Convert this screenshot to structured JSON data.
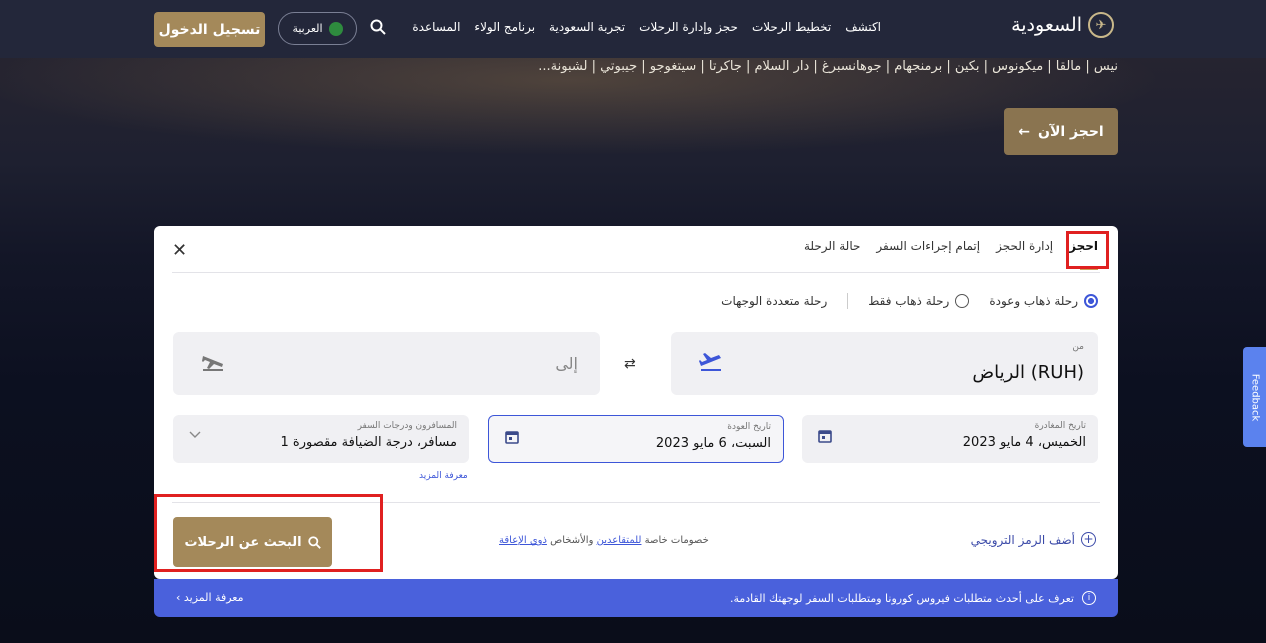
{
  "header": {
    "logo_text": "السعودية",
    "logo_mark": "✈",
    "nav": [
      "اكتشف",
      "تخطيط الرحلات",
      "حجز وإدارة الرحلات",
      "تجربة السعودية",
      "برنامج الولاء",
      "المساعدة"
    ],
    "search_icon": "search-icon",
    "language": "العربية",
    "login": "تسجيل الدخول"
  },
  "hero": {
    "text": "نيس | مالقا | ميكونوس | بكين | برمنجهام | جوهانسبرغ | دار السلام | جاكرتا | سيتغوجو | جيبوتي | لشبونة...",
    "book_now": "احجز الآن",
    "book_now_arrow": "←"
  },
  "feedback": "Feedback",
  "panel": {
    "close": "✕",
    "tabs": [
      "احجز",
      "إدارة الحجز",
      "إتمام إجراءات السفر",
      "حالة الرحلة"
    ],
    "trip_types": [
      "رحلة ذهاب وعودة",
      "رحلة ذهاب فقط",
      "رحلة متعددة الوجهات"
    ],
    "from_label": "من",
    "from_value": "الرياض (RUH)",
    "to_placeholder": "إلى",
    "swap": "⇄",
    "departure_label": "تاريخ المغادرة",
    "departure_value": "الخميس، 4 مايو 2023",
    "return_label": "تاريخ العودة",
    "return_value": "السبت، 6 مايو 2023",
    "pax_label": "المسافرون ودرجات السفر",
    "pax_value": "1 مسافر، درجة الضيافة مقصورة",
    "learn_more": "معرفة المزيد",
    "promo": "أضف الرمز الترويجي",
    "discount_prefix": "خصومات خاصة",
    "discount_link1": "للمتقاعدين",
    "discount_mid": "والأشخاص",
    "discount_link2": "ذوي الإعاقة",
    "search": "البحث عن الرحلات"
  },
  "banner": {
    "text": "تعرف على أحدث متطلبات فيروس كورونا ومتطلبات السفر لوجهتك القادمة.",
    "link": "معرفة المزيد ›"
  }
}
